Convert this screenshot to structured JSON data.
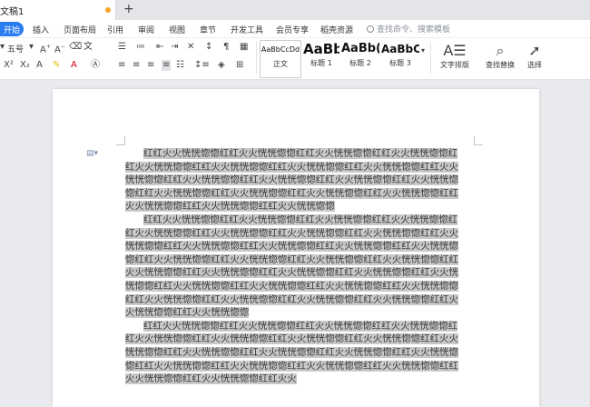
{
  "titlebar": {
    "doc_title": "文稿1",
    "new_tab_glyph": "+"
  },
  "menu": {
    "items": [
      "开始",
      "插入",
      "页面布局",
      "引用",
      "审阅",
      "视图",
      "章节",
      "开发工具",
      "会员专享",
      "稻壳资源"
    ],
    "search_placeholder": "查找命令、搜索模板"
  },
  "ribbon": {
    "font_size": "五号",
    "styles": [
      {
        "sample": "AaBbCcDd",
        "name": "正文"
      },
      {
        "sample": "AaBb",
        "name": "标题 1"
      },
      {
        "sample": "AaBb(",
        "name": "标题 2"
      },
      {
        "sample": "AaBbC",
        "name": "标题 3"
      }
    ],
    "text_layout_label": "文字排版",
    "find_replace_label": "查找替换",
    "select_label": "选择"
  },
  "document": {
    "paragraphs": [
      "红红火火恍恍惚惚红红火火恍恍惚惚红红火火恍恍惚惚红红火火恍恍惚惚红红火火恍恍惚惚红红火火恍恍惚惚红红火火恍恍惚惚红红火火恍恍惚惚红红火火恍恍惚惚红红火火恍恍惚惚红红火火恍恍惚惚红红火火恍恍惚惚红红火火恍恍惚惚红红火火恍恍惚惚红红火火恍恍惚惚红红火火恍恍惚惚红红火火恍恍惚惚红红火火恍恍惚惚红红火火恍恍惚惚红红火火恍恍惚惚",
      "红红火火恍恍惚惚红红火火恍恍惚惚红红火火恍恍惚惚红红火火恍恍惚惚红红火火恍恍惚惚红红火火恍恍惚惚红红火火恍恍惚惚红红火火恍恍惚惚红红火火恍恍惚惚红红火火恍恍惚惚红红火火恍恍惚惚红红火火恍恍惚惚红红火火恍恍惚惚红红火火恍恍惚惚红红火火恍恍惚惚红红火火恍恍惚惚红红火火恍恍惚惚红红火火恍恍惚惚红红火火恍恍惚惚红红火火恍恍惚惚红红火火恍恍惚惚红红火火恍恍惚惚红红火火恍恍惚惚红红火火恍恍惚惚红红火火恍恍惚惚红红火火恍恍惚惚红红火火恍恍惚惚红红火火恍恍惚惚红红火火恍恍惚惚红红火火恍恍惚惚红红火火恍恍惚惚红红火火恍恍惚惚",
      "红红火火恍恍惚惚红红火火恍恍惚惚红红火火恍恍惚惚红红火火恍恍惚惚红红火火恍恍惚惚红红火火恍恍惚惚红红火火恍恍惚惚红红火火恍恍惚惚红红火火恍恍惚惚红红火火恍恍惚惚红红火火恍恍惚惚红红火火恍恍惚惚红红火火恍恍惚惚红红火火恍恍惚惚红红火火恍恍惚惚红红火火恍恍惚惚红红火火恍恍惚惚红红火火恍恍惚惚红红火火恍恍惚惚红红火火"
    ]
  },
  "colors": {
    "accent": "#2a7cf1",
    "selection": "#c8c9cb",
    "modified_dot": "#f5a623"
  }
}
